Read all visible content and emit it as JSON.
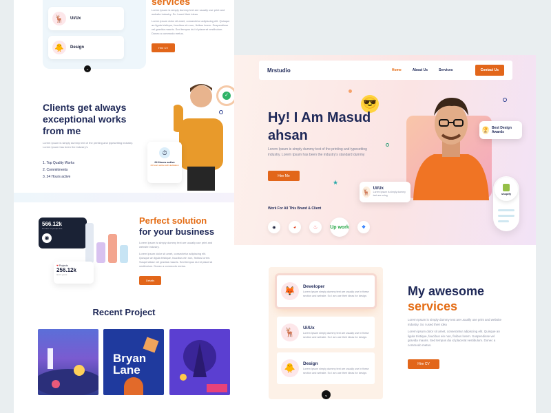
{
  "left": {
    "top_services": [
      {
        "title": "Ui/Ux",
        "icon": "uiux-icon",
        "emoji": "🦌"
      },
      {
        "title": "Design",
        "icon": "design-icon",
        "emoji": "🐥"
      }
    ],
    "services_title_partial": "services",
    "top_para1": "Lorem Ipsum is simply dummy text are usually use print and website industry. So I used their ideas",
    "top_para2": "Lorem ipsum dolor sit amet, consectetur adipiscing elit. Quisque an ligula tristique, faucibus ein non, finibus lorem. Suspendisse vel gravida mauris. Sed tempus dui id placerat vestibulum. Donec a commodo metus.",
    "top_button": "Hire CV",
    "clients_title": "Clients get always exceptional works from me",
    "clients_para": "Lorem Ipsum is simply dummy text of the printing and typesetting industry. Lorem Ipsum has been the industry's",
    "clients_list": [
      "1. Top Quality Works",
      "2. Commitments",
      "3. 24 Hours active"
    ],
    "stat_card": {
      "label": "24 Hours active",
      "sub": "24 hours active with dedication"
    },
    "dark_card": {
      "number": "566.12k",
      "label": "Number of people this"
    },
    "projects_card": {
      "label": "Projects",
      "number": "256.12k",
      "sub": "last 3 years"
    },
    "perfect_title_orange": "Perfect solution",
    "perfect_title_dark": "for your business",
    "perfect_para1": "Lorem Ipsum is simply dummy text are usually use print and website industry.",
    "perfect_para2": "Lorem ipsum dolor sit amet, consectetur adipiscing elit. Quisque an ligula tristique, faucibus ein non, finibus lorem. Suspendisse vel gravida mauris. Sed tempus dui id placerat vestibulum. Donec a commodo metus.",
    "perfect_button": "Details",
    "recent_title": "Recent Project",
    "thumb2_text": "Bryan Lane"
  },
  "nav": {
    "brand": "Mrstudio",
    "links": [
      "Home",
      "About Us",
      "Services"
    ],
    "cta": "Contact Us"
  },
  "hero": {
    "title": "Hy! I Am Masud ahsan",
    "para": "Lorem Ipsum is simply dummy text of the printing and typesetting industry. Lorem Ipsum has been the industry's standard dummy",
    "button": "Hire Me",
    "award": "Best Design Awards",
    "uiux_chip": {
      "title": "Ui/Ux",
      "desc": "Lorem Ipsum is simply dummy text are using"
    },
    "shopify": "shopify",
    "work_for": "Work For All This Brand & Client",
    "brands": [
      "◉",
      "◕",
      "♨",
      "Up work",
      "❖"
    ]
  },
  "services": {
    "items": [
      {
        "title": "Developer",
        "desc": "Lorem Ipsum simply dummy text are usually use in these section and website. So I am use their ideas for design.",
        "emoji": "🦊"
      },
      {
        "title": "Ui/Ux",
        "desc": "Lorem Ipsum simply dummy text are usually use in these section and website. So I am use their ideas for design.",
        "emoji": "🦌"
      },
      {
        "title": "Design",
        "desc": "Lorem Ipsum simply dummy text are usually use in these section and website. So I am use their ideas for design.",
        "emoji": "🐥"
      }
    ],
    "title_dark": "My awesome",
    "title_orange": "services",
    "para1": "Lorem Ipsum is simply dummy text are usually use print and website industry. So I used their idea",
    "para2": "Lorem ipsum dolor sit amet, consectetur adipiscing elit. Quisque an ligula tristique, faucibus ein non, finibus lorem. Suspendisse vel gravida mauris. Sed tempus dui id placerat vestibulum. Donec a commodo metus.",
    "button": "Hire CV"
  },
  "colors": {
    "accent": "#e2661a",
    "navy": "#1e2857"
  }
}
